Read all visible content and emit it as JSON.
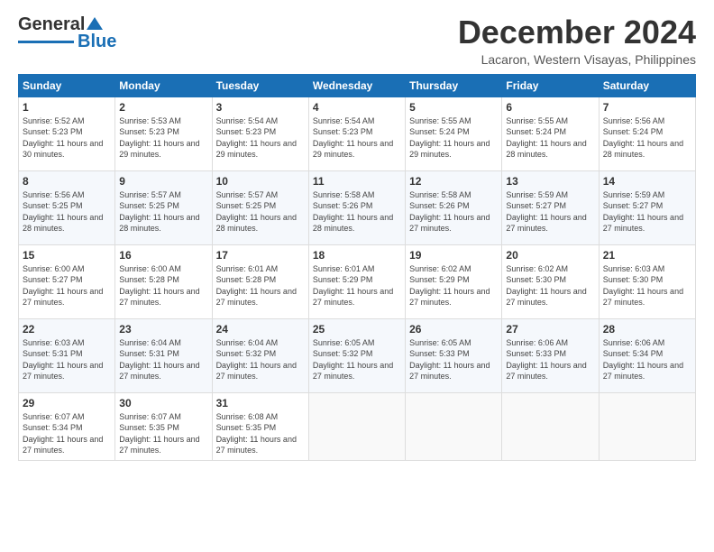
{
  "logo": {
    "line1": "General",
    "line2": "Blue"
  },
  "header": {
    "month": "December 2024",
    "location": "Lacaron, Western Visayas, Philippines"
  },
  "weekdays": [
    "Sunday",
    "Monday",
    "Tuesday",
    "Wednesday",
    "Thursday",
    "Friday",
    "Saturday"
  ],
  "weeks": [
    [
      {
        "day": "1",
        "sunrise": "5:52 AM",
        "sunset": "5:23 PM",
        "daylight": "11 hours and 30 minutes."
      },
      {
        "day": "2",
        "sunrise": "5:53 AM",
        "sunset": "5:23 PM",
        "daylight": "11 hours and 29 minutes."
      },
      {
        "day": "3",
        "sunrise": "5:54 AM",
        "sunset": "5:23 PM",
        "daylight": "11 hours and 29 minutes."
      },
      {
        "day": "4",
        "sunrise": "5:54 AM",
        "sunset": "5:23 PM",
        "daylight": "11 hours and 29 minutes."
      },
      {
        "day": "5",
        "sunrise": "5:55 AM",
        "sunset": "5:24 PM",
        "daylight": "11 hours and 29 minutes."
      },
      {
        "day": "6",
        "sunrise": "5:55 AM",
        "sunset": "5:24 PM",
        "daylight": "11 hours and 28 minutes."
      },
      {
        "day": "7",
        "sunrise": "5:56 AM",
        "sunset": "5:24 PM",
        "daylight": "11 hours and 28 minutes."
      }
    ],
    [
      {
        "day": "8",
        "sunrise": "5:56 AM",
        "sunset": "5:25 PM",
        "daylight": "11 hours and 28 minutes."
      },
      {
        "day": "9",
        "sunrise": "5:57 AM",
        "sunset": "5:25 PM",
        "daylight": "11 hours and 28 minutes."
      },
      {
        "day": "10",
        "sunrise": "5:57 AM",
        "sunset": "5:25 PM",
        "daylight": "11 hours and 28 minutes."
      },
      {
        "day": "11",
        "sunrise": "5:58 AM",
        "sunset": "5:26 PM",
        "daylight": "11 hours and 28 minutes."
      },
      {
        "day": "12",
        "sunrise": "5:58 AM",
        "sunset": "5:26 PM",
        "daylight": "11 hours and 27 minutes."
      },
      {
        "day": "13",
        "sunrise": "5:59 AM",
        "sunset": "5:27 PM",
        "daylight": "11 hours and 27 minutes."
      },
      {
        "day": "14",
        "sunrise": "5:59 AM",
        "sunset": "5:27 PM",
        "daylight": "11 hours and 27 minutes."
      }
    ],
    [
      {
        "day": "15",
        "sunrise": "6:00 AM",
        "sunset": "5:27 PM",
        "daylight": "11 hours and 27 minutes."
      },
      {
        "day": "16",
        "sunrise": "6:00 AM",
        "sunset": "5:28 PM",
        "daylight": "11 hours and 27 minutes."
      },
      {
        "day": "17",
        "sunrise": "6:01 AM",
        "sunset": "5:28 PM",
        "daylight": "11 hours and 27 minutes."
      },
      {
        "day": "18",
        "sunrise": "6:01 AM",
        "sunset": "5:29 PM",
        "daylight": "11 hours and 27 minutes."
      },
      {
        "day": "19",
        "sunrise": "6:02 AM",
        "sunset": "5:29 PM",
        "daylight": "11 hours and 27 minutes."
      },
      {
        "day": "20",
        "sunrise": "6:02 AM",
        "sunset": "5:30 PM",
        "daylight": "11 hours and 27 minutes."
      },
      {
        "day": "21",
        "sunrise": "6:03 AM",
        "sunset": "5:30 PM",
        "daylight": "11 hours and 27 minutes."
      }
    ],
    [
      {
        "day": "22",
        "sunrise": "6:03 AM",
        "sunset": "5:31 PM",
        "daylight": "11 hours and 27 minutes."
      },
      {
        "day": "23",
        "sunrise": "6:04 AM",
        "sunset": "5:31 PM",
        "daylight": "11 hours and 27 minutes."
      },
      {
        "day": "24",
        "sunrise": "6:04 AM",
        "sunset": "5:32 PM",
        "daylight": "11 hours and 27 minutes."
      },
      {
        "day": "25",
        "sunrise": "6:05 AM",
        "sunset": "5:32 PM",
        "daylight": "11 hours and 27 minutes."
      },
      {
        "day": "26",
        "sunrise": "6:05 AM",
        "sunset": "5:33 PM",
        "daylight": "11 hours and 27 minutes."
      },
      {
        "day": "27",
        "sunrise": "6:06 AM",
        "sunset": "5:33 PM",
        "daylight": "11 hours and 27 minutes."
      },
      {
        "day": "28",
        "sunrise": "6:06 AM",
        "sunset": "5:34 PM",
        "daylight": "11 hours and 27 minutes."
      }
    ],
    [
      {
        "day": "29",
        "sunrise": "6:07 AM",
        "sunset": "5:34 PM",
        "daylight": "11 hours and 27 minutes."
      },
      {
        "day": "30",
        "sunrise": "6:07 AM",
        "sunset": "5:35 PM",
        "daylight": "11 hours and 27 minutes."
      },
      {
        "day": "31",
        "sunrise": "6:08 AM",
        "sunset": "5:35 PM",
        "daylight": "11 hours and 27 minutes."
      },
      null,
      null,
      null,
      null
    ]
  ]
}
